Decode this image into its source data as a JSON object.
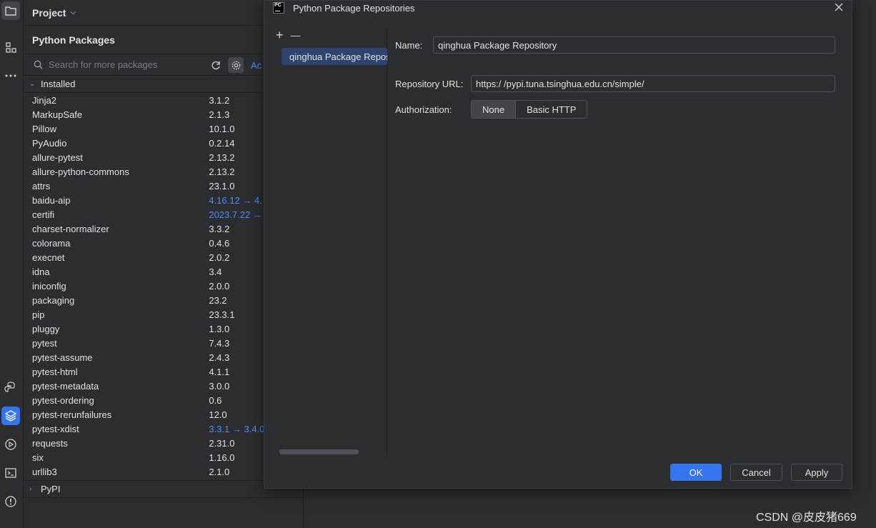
{
  "project_menu": {
    "label": "Project"
  },
  "panel": {
    "title": "Python Packages",
    "search_placeholder": "Search for more packages",
    "add_link": "Ac",
    "installed_label": "Installed",
    "pypi_label": "PyPI",
    "packages": [
      {
        "name": "Jinja2",
        "version": "3.1.2",
        "upgrade": false
      },
      {
        "name": "MarkupSafe",
        "version": "2.1.3",
        "upgrade": false
      },
      {
        "name": "Pillow",
        "version": "10.1.0",
        "upgrade": false
      },
      {
        "name": "PyAudio",
        "version": "0.2.14",
        "upgrade": false
      },
      {
        "name": "allure-pytest",
        "version": "2.13.2",
        "upgrade": false
      },
      {
        "name": "allure-python-commons",
        "version": "2.13.2",
        "upgrade": false
      },
      {
        "name": "attrs",
        "version": "23.1.0",
        "upgrade": false
      },
      {
        "name": "baidu-aip",
        "version": "4.16.12 → 4.",
        "upgrade": true
      },
      {
        "name": "certifi",
        "version": "2023.7.22 →",
        "upgrade": true
      },
      {
        "name": "charset-normalizer",
        "version": "3.3.2",
        "upgrade": false
      },
      {
        "name": "colorama",
        "version": "0.4.6",
        "upgrade": false
      },
      {
        "name": "execnet",
        "version": "2.0.2",
        "upgrade": false
      },
      {
        "name": "idna",
        "version": "3.4",
        "upgrade": false
      },
      {
        "name": "iniconfig",
        "version": "2.0.0",
        "upgrade": false
      },
      {
        "name": "packaging",
        "version": "23.2",
        "upgrade": false
      },
      {
        "name": "pip",
        "version": "23.3.1",
        "upgrade": false
      },
      {
        "name": "pluggy",
        "version": "1.3.0",
        "upgrade": false
      },
      {
        "name": "pytest",
        "version": "7.4.3",
        "upgrade": false
      },
      {
        "name": "pytest-assume",
        "version": "2.4.3",
        "upgrade": false
      },
      {
        "name": "pytest-html",
        "version": "4.1.1",
        "upgrade": false
      },
      {
        "name": "pytest-metadata",
        "version": "3.0.0",
        "upgrade": false
      },
      {
        "name": "pytest-ordering",
        "version": "0.6",
        "upgrade": false
      },
      {
        "name": "pytest-rerunfailures",
        "version": "12.0",
        "upgrade": false
      },
      {
        "name": "pytest-xdist",
        "version": "3.3.1 → 3.4.0",
        "upgrade": true
      },
      {
        "name": "requests",
        "version": "2.31.0",
        "upgrade": false
      },
      {
        "name": "six",
        "version": "1.16.0",
        "upgrade": false
      },
      {
        "name": "urllib3",
        "version": "2.1.0",
        "upgrade": false
      }
    ]
  },
  "dialog": {
    "logo": "PC",
    "title": "Python Package Repositories",
    "add": "+",
    "remove": "—",
    "selected_repo": "qinghua Package Repository",
    "name_label": "Name:",
    "name_value": "qinghua Package Repository",
    "url_label": "Repository URL:",
    "url_value": "https:/ /pypi.tuna.tsinghua.edu.cn/simple/",
    "auth_label": "Authorization:",
    "auth_options": [
      "None",
      "Basic HTTP"
    ],
    "auth_selected": "None",
    "ok": "OK",
    "cancel": "Cancel",
    "apply": "Apply"
  },
  "watermark": "CSDN @皮皮猪669",
  "colors": {
    "accent": "#3574f0",
    "selection": "#2e436e",
    "upgrade_link": "#548af7",
    "background": "#2b2d30"
  }
}
